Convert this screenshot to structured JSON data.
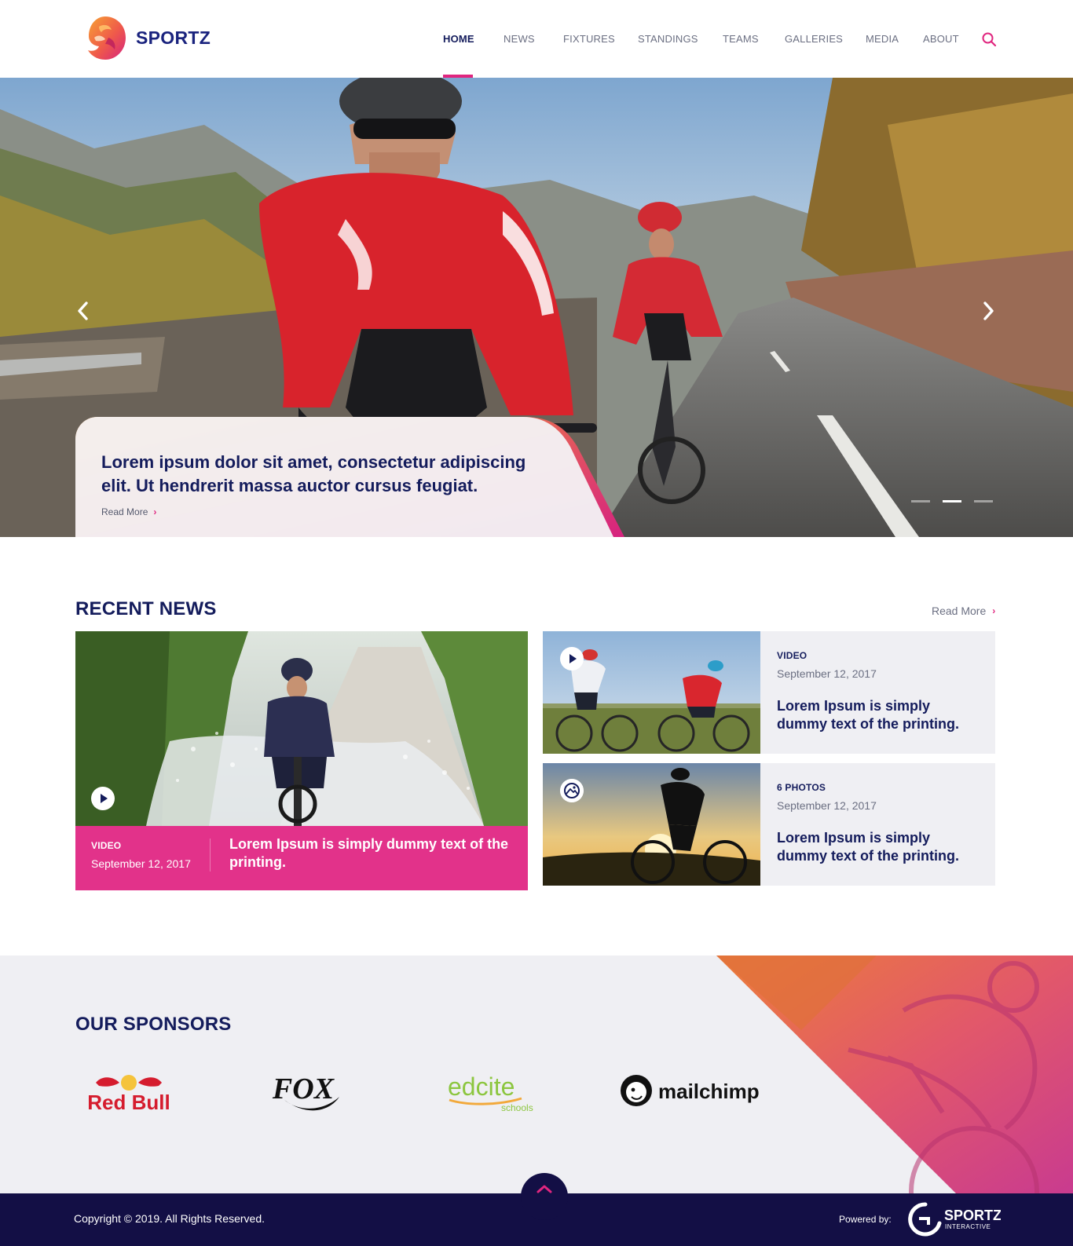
{
  "brand": {
    "name": "SPORTZ"
  },
  "nav": {
    "items": [
      {
        "label": "HOME",
        "active": true
      },
      {
        "label": "NEWS"
      },
      {
        "label": "FIXTURES"
      },
      {
        "label": "STANDINGS"
      },
      {
        "label": "TEAMS"
      },
      {
        "label": "GALLERIES"
      },
      {
        "label": "MEDIA"
      },
      {
        "label": "ABOUT"
      }
    ],
    "search_icon": "search-icon"
  },
  "hero": {
    "title": "Lorem ipsum dolor sit amet, consectetur adipiscing elit. Ut hendrerit massa auctor cursus feugiat.",
    "read_more": "Read More",
    "slides": 3,
    "active_slide": 2,
    "prev_icon": "chevron-left-icon",
    "next_icon": "chevron-right-icon"
  },
  "recent_news": {
    "title": "RECENT NEWS",
    "read_more": "Read More",
    "featured": {
      "type": "VIDEO",
      "date": "September 12, 2017",
      "headline": "Lorem Ipsum is simply dummy text of the printing."
    },
    "side": [
      {
        "type": "VIDEO",
        "date": "September 12, 2017",
        "headline": "Lorem Ipsum is simply dummy text of the printing.",
        "icon": "play-icon"
      },
      {
        "type": "6 PHOTOS",
        "date": "September 12, 2017",
        "headline": "Lorem Ipsum is simply dummy text of the printing.",
        "icon": "gallery-icon"
      }
    ]
  },
  "sponsors": {
    "title": "OUR SPONSORS",
    "logos": [
      "Red Bull",
      "FOX",
      "edcite",
      "schools",
      "mailchimp"
    ]
  },
  "footer": {
    "copyright": "Copyright © 2019.  All Rights Reserved.",
    "powered_by": "Powered by:",
    "logo_text": "SPORTZ",
    "logo_sub": "INTERACTIVE"
  },
  "colors": {
    "navy": "#141c5c",
    "accent": "#e0267f",
    "footer_bg": "#130f45",
    "light_bg": "#efeff3"
  }
}
